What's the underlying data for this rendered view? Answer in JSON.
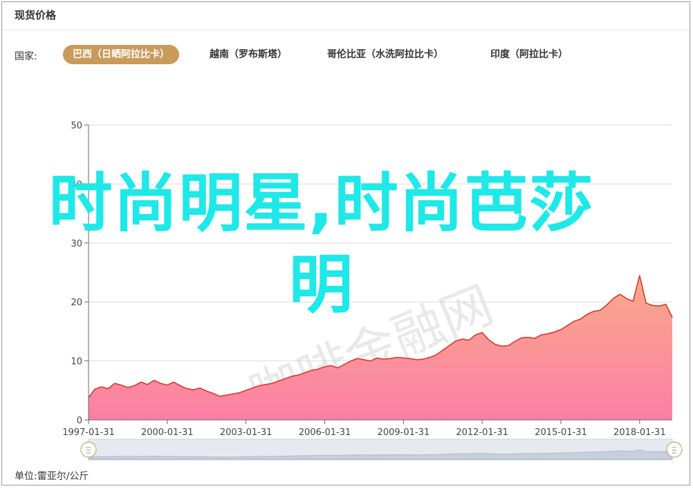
{
  "header": {
    "title": "现货价格"
  },
  "filter": {
    "label": "国家:",
    "tabs": [
      {
        "label": "巴西（日晒阿拉比卡）",
        "active": true
      },
      {
        "label": "越南（罗布斯塔）",
        "active": false
      },
      {
        "label": "哥伦比亚（水洗阿拉比卡）",
        "active": false
      },
      {
        "label": "印度（阿拉比卡）",
        "active": false
      }
    ]
  },
  "overlay_text": "时尚明星,时尚芭莎明",
  "watermark": "咖啡金融网",
  "unit": {
    "label": "单位:",
    "value": "雷亚尔/公斤"
  },
  "colors": {
    "accent": "#c89a5c",
    "line": "#d43a2f",
    "area_top": "#f9a98a",
    "area_bottom": "#fc7fa5",
    "overlay": "#1ee8e8"
  },
  "chart_data": {
    "type": "area",
    "title": "",
    "xlabel": "",
    "ylabel": "",
    "ylim": [
      0,
      50
    ],
    "yticks": [
      0,
      10,
      20,
      30,
      40,
      50
    ],
    "xlim": [
      "1997-01-31",
      "2019-04-30"
    ],
    "xticks": [
      "1997-01-31",
      "2000-01-31",
      "2003-01-31",
      "2006-01-31",
      "2009-01-31",
      "2012-01-31",
      "2015-01-31",
      "2018-01-31"
    ],
    "grid": true,
    "legend": "none",
    "x": [
      "1997-01-31",
      "1997-04-30",
      "1997-07-31",
      "1997-10-31",
      "1998-01-31",
      "1998-04-30",
      "1998-07-31",
      "1998-10-31",
      "1999-01-31",
      "1999-04-30",
      "1999-07-31",
      "1999-10-31",
      "2000-01-31",
      "2000-04-30",
      "2000-07-31",
      "2000-10-31",
      "2001-01-31",
      "2001-04-30",
      "2001-07-31",
      "2001-10-31",
      "2002-01-31",
      "2002-04-30",
      "2002-07-31",
      "2002-10-31",
      "2003-01-31",
      "2003-04-30",
      "2003-07-31",
      "2003-10-31",
      "2004-01-31",
      "2004-04-30",
      "2004-07-31",
      "2004-10-31",
      "2005-01-31",
      "2005-04-30",
      "2005-07-31",
      "2005-10-31",
      "2006-01-31",
      "2006-04-30",
      "2006-07-31",
      "2006-10-31",
      "2007-01-31",
      "2007-04-30",
      "2007-07-31",
      "2007-10-31",
      "2008-01-31",
      "2008-04-30",
      "2008-07-31",
      "2008-10-31",
      "2009-01-31",
      "2009-04-30",
      "2009-07-31",
      "2009-10-31",
      "2010-01-31",
      "2010-04-30",
      "2010-07-31",
      "2010-10-31",
      "2011-01-31",
      "2011-04-30",
      "2011-07-31",
      "2011-10-31",
      "2012-01-31",
      "2012-04-30",
      "2012-07-31",
      "2012-10-31",
      "2013-01-31",
      "2013-04-30",
      "2013-07-31",
      "2013-10-31",
      "2014-01-31",
      "2014-04-30",
      "2014-07-31",
      "2014-10-31",
      "2015-01-31",
      "2015-04-30",
      "2015-07-31",
      "2015-10-31",
      "2016-01-31",
      "2016-04-30",
      "2016-07-31",
      "2016-10-31",
      "2017-01-31",
      "2017-04-30",
      "2017-07-31",
      "2017-10-31",
      "2018-01-31",
      "2018-04-30",
      "2018-07-31",
      "2018-10-31",
      "2019-01-31",
      "2019-04-30"
    ],
    "values": [
      3.8,
      5.2,
      5.6,
      5.3,
      6.2,
      5.9,
      5.5,
      5.8,
      6.4,
      6.0,
      6.7,
      6.2,
      5.9,
      6.4,
      5.8,
      5.3,
      5.1,
      5.4,
      4.9,
      4.5,
      4.0,
      4.2,
      4.4,
      4.6,
      5.0,
      5.4,
      5.8,
      6.0,
      6.2,
      6.6,
      7.0,
      7.4,
      7.6,
      8.0,
      8.4,
      8.6,
      9.0,
      9.2,
      8.8,
      9.4,
      10.0,
      10.4,
      10.2,
      10.0,
      10.5,
      10.3,
      10.4,
      10.6,
      10.5,
      10.4,
      10.2,
      10.3,
      10.6,
      11.0,
      11.8,
      12.6,
      13.4,
      13.7,
      13.5,
      14.4,
      14.8,
      13.6,
      12.8,
      12.5,
      12.6,
      13.3,
      13.9,
      14.0,
      13.8,
      14.4,
      14.6,
      14.9,
      15.3,
      16.0,
      16.7,
      17.1,
      17.9,
      18.4,
      18.6,
      19.5,
      20.6,
      21.3,
      20.6,
      20.1,
      24.5,
      19.8,
      19.4,
      19.3,
      19.6,
      17.4
    ]
  }
}
